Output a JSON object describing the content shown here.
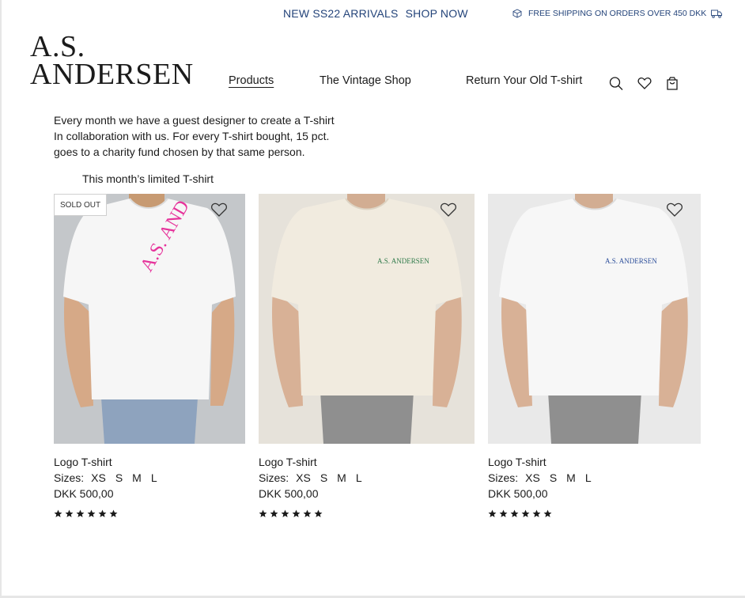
{
  "topbar": {
    "promo_text": "NEW SS22 ARRIVALS",
    "promo_link": "SHOP NOW",
    "shipping_text": "FREE SHIPPING ON ORDERS OVER 450 DKK"
  },
  "brand": {
    "line1": "A.S.",
    "line2": "ANDERSEN"
  },
  "nav": {
    "products": "Products",
    "vintage": "The Vintage Shop",
    "return": "Return Your Old T-shirt"
  },
  "header_icons": [
    "search-icon",
    "heart-icon",
    "bag-icon"
  ],
  "intro": {
    "lines": [
      "Every month we have a guest designer to create a T-shirt",
      "In collaboration with us. For every T-shirt bought, 15 pct.",
      "goes to a charity fund chosen by that same person."
    ],
    "subheading": "This month’s limited T-shirt"
  },
  "products": [
    {
      "badge": "SOLD OUT",
      "name": "Logo T-shirt",
      "sizes_label": "Sizes:",
      "sizes": [
        "XS",
        "S",
        "M",
        "L"
      ],
      "price": "DKK 500,00",
      "rating": 6,
      "print_text": "A.S. AND",
      "print_color": "#e6339b",
      "shirt_color": "#f6f6f6",
      "bg_color": "#c4c7ca"
    },
    {
      "badge": "",
      "name": "Logo T-shirt",
      "sizes_label": "Sizes:",
      "sizes": [
        "XS",
        "S",
        "M",
        "L"
      ],
      "price": "DKK 500,00",
      "rating": 6,
      "print_text": "A.S. ANDERSEN",
      "print_color": "#2f7a4a",
      "shirt_color": "#f1ebdf",
      "bg_color": "#e6e2da"
    },
    {
      "badge": "",
      "name": "Logo T-shirt",
      "sizes_label": "Sizes:",
      "sizes": [
        "XS",
        "S",
        "M",
        "L"
      ],
      "price": "DKK 500,00",
      "rating": 6,
      "print_text": "A.S. ANDERSEN",
      "print_color": "#2c4e9a",
      "shirt_color": "#f7f7f7",
      "bg_color": "#e9e9e9"
    }
  ],
  "colors": {
    "accent": "#24447a",
    "text": "#1b1b1b"
  }
}
